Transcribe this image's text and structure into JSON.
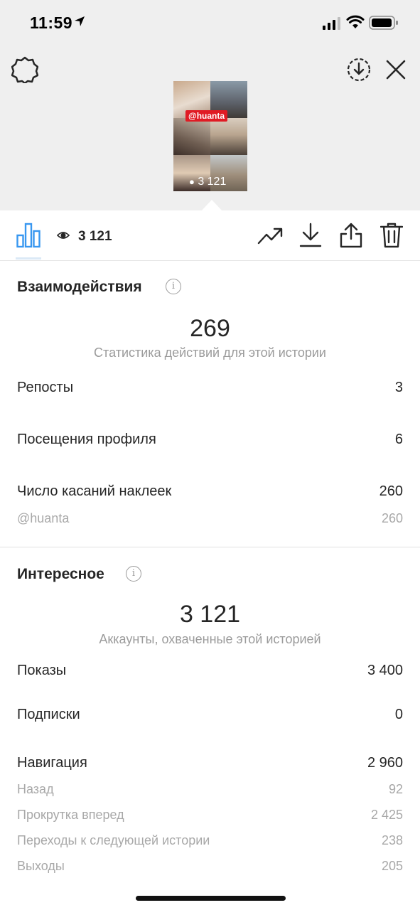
{
  "status": {
    "time": "11:59"
  },
  "preview": {
    "mention_tag": "@huanta",
    "views": "3 121"
  },
  "toolbar": {
    "views_count": "3 121"
  },
  "interactions": {
    "title": "Взаимодействия",
    "total": "269",
    "caption": "Статистика действий для этой истории",
    "rows": [
      {
        "label": "Репосты",
        "value": "3"
      },
      {
        "label": "Посещения профиля",
        "value": "6"
      },
      {
        "label": "Число касаний наклеек",
        "value": "260"
      }
    ],
    "sub_rows": [
      {
        "label": "@huanta",
        "value": "260"
      }
    ]
  },
  "discovery": {
    "title": "Интересное",
    "total": "3 121",
    "caption": "Аккаунты, охваченные этой историей",
    "rows": [
      {
        "label": "Показы",
        "value": "3 400"
      },
      {
        "label": "Подписки",
        "value": "0"
      },
      {
        "label": "Навигация",
        "value": "2 960"
      }
    ],
    "sub_rows": [
      {
        "label": "Назад",
        "value": "92"
      },
      {
        "label": "Прокрутка вперед",
        "value": "2 425"
      },
      {
        "label": "Переходы к следующей истории",
        "value": "238"
      },
      {
        "label": "Выходы",
        "value": "205"
      }
    ]
  },
  "colors": {
    "accent": "#3897f0",
    "tag_red": "#e01b24",
    "muted": "#9b9b9b"
  }
}
